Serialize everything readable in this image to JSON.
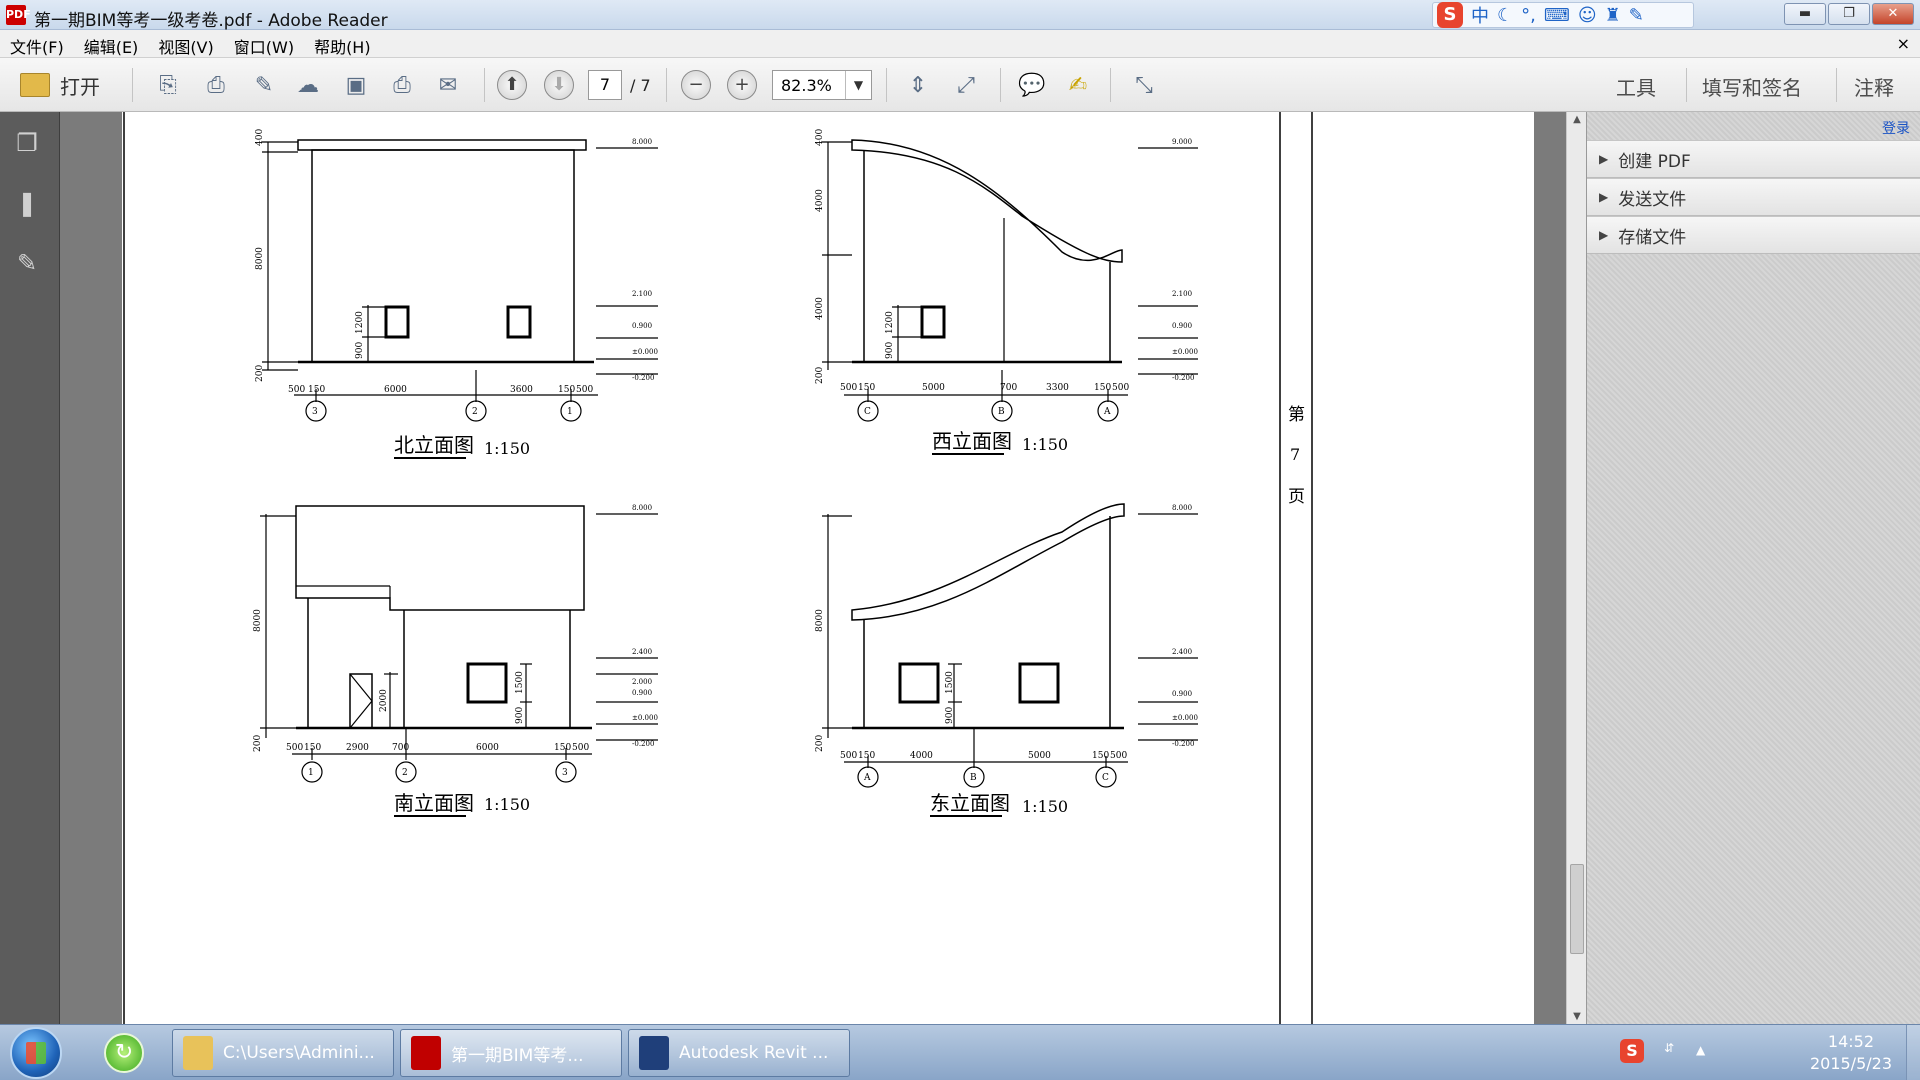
{
  "window": {
    "title": "第一期BIM等考一级考卷.pdf - Adobe Reader",
    "app_icon": "PDF",
    "ime_label": "中",
    "ime_logo": "S",
    "controls": {
      "minimize": "▬",
      "restore": "❐",
      "close": "✕"
    }
  },
  "menu": {
    "items": [
      "文件(F)",
      "编辑(E)",
      "视图(V)",
      "窗口(W)",
      "帮助(H)"
    ],
    "doc_close": "×"
  },
  "toolbar": {
    "open_label": "打开",
    "page_current": "7",
    "page_total": "/ 7",
    "zoom": "82.3%",
    "right_tabs": [
      "工具",
      "填写和签名",
      "注释"
    ]
  },
  "right_panel": {
    "login": "登录",
    "sections": [
      "创建 PDF",
      "发送文件",
      "存储文件"
    ]
  },
  "page_label": [
    "第",
    "7",
    "页"
  ],
  "drawings": {
    "north": {
      "title": "北立面图",
      "scale": "1:150",
      "dims_bottom": [
        "500",
        "150",
        "6000",
        "3600",
        "150",
        "500"
      ],
      "dims_left": [
        "400",
        "8000",
        "200"
      ],
      "dims_window": [
        "1200",
        "900"
      ],
      "axes": [
        "3",
        "2",
        "1"
      ],
      "levels": [
        "8.000",
        "2.100",
        "0.900",
        "±0.000",
        "-0.200"
      ]
    },
    "west": {
      "title": "西立面图",
      "scale": "1:150",
      "dims_bottom": [
        "500",
        "150",
        "5000",
        "700",
        "3300",
        "150",
        "500"
      ],
      "dims_left": [
        "400",
        "4000",
        "4000",
        "200"
      ],
      "dims_window": [
        "1200",
        "900"
      ],
      "axes": [
        "C",
        "B",
        "A"
      ],
      "levels": [
        "9.000",
        "2.100",
        "0.900",
        "±0.000",
        "-0.200"
      ]
    },
    "south": {
      "title": "南立面图",
      "scale": "1:150",
      "dims_bottom": [
        "500",
        "150",
        "2900",
        "700",
        "6000",
        "150",
        "500"
      ],
      "dims_left": [
        "8000",
        "200"
      ],
      "dims_window": [
        "1500",
        "900",
        "2000"
      ],
      "axes": [
        "1",
        "2",
        "3"
      ],
      "levels": [
        "8.000",
        "2.400",
        "2.000",
        "0.900",
        "±0.000",
        "-0.200"
      ]
    },
    "east": {
      "title": "东立面图",
      "scale": "1:150",
      "dims_bottom": [
        "500",
        "150",
        "4000",
        "5000",
        "150",
        "500"
      ],
      "dims_left": [
        "8000",
        "200"
      ],
      "dims_window": [
        "1500",
        "900"
      ],
      "axes": [
        "A",
        "B",
        "C"
      ],
      "levels": [
        "8.000",
        "2.400",
        "0.900",
        "±0.000",
        "-0.200"
      ]
    }
  },
  "taskbar": {
    "tasks": [
      "C:\\Users\\Admini...",
      "第一期BIM等考...",
      "Autodesk Revit ..."
    ],
    "tray_logo": "S",
    "time": "14:52",
    "date": "2015/5/23"
  },
  "colors": {
    "pdf_red": "#c00000",
    "folder": "#e2b94a",
    "revit_blue": "#1f3f7a",
    "taskbar": "#9fb8d6"
  }
}
